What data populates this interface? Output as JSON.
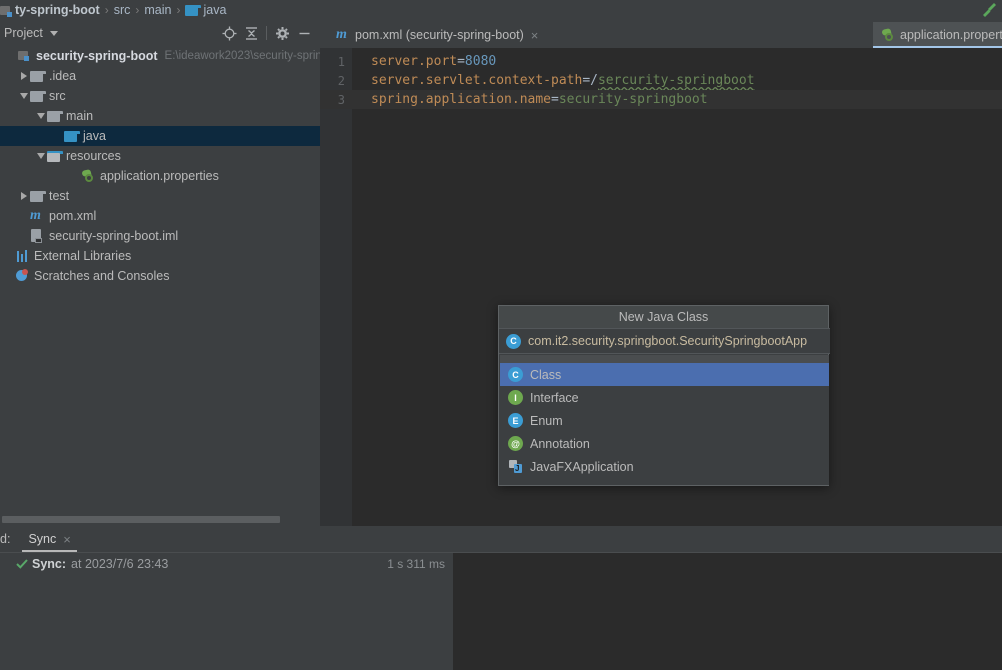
{
  "breadcrumb": {
    "items": [
      {
        "label": "ty-spring-boot",
        "icon": "module-icon",
        "bold": true
      },
      {
        "label": "src",
        "icon": "none",
        "bold": false
      },
      {
        "label": "main",
        "icon": "none",
        "bold": false
      },
      {
        "label": "java",
        "icon": "folder-icon",
        "bold": false
      }
    ],
    "separator": "›",
    "build_icon": "hammer-icon"
  },
  "project_panel": {
    "title": "Project",
    "toolbar": [
      {
        "name": "locate-icon",
        "label": "Select Opened File"
      },
      {
        "name": "collapse-all-icon",
        "label": "Collapse All"
      },
      {
        "name": "gear-icon",
        "label": "Settings"
      },
      {
        "name": "minimize-icon",
        "label": "Hide"
      }
    ],
    "tree": [
      {
        "indent": 0,
        "arrow": "none",
        "icon": "module-icon",
        "label": "security-spring-boot",
        "bold": true,
        "path": "E:\\ideawork2023\\security-sprin",
        "selected": false
      },
      {
        "indent": 1,
        "arrow": "right",
        "icon": "folder-grey",
        "label": ".idea",
        "bold": false,
        "path": "",
        "selected": false
      },
      {
        "indent": 1,
        "arrow": "down",
        "icon": "folder-grey",
        "label": "src",
        "bold": false,
        "path": "",
        "selected": false
      },
      {
        "indent": 2,
        "arrow": "down",
        "icon": "folder-grey",
        "label": "main",
        "bold": false,
        "path": "",
        "selected": false
      },
      {
        "indent": 3,
        "arrow": "none",
        "icon": "folder-blue",
        "label": "java",
        "bold": false,
        "path": "",
        "selected": true
      },
      {
        "indent": 3,
        "arrow": "down",
        "icon": "folder-res",
        "label": "resources",
        "bold": false,
        "path": "",
        "selected": false
      },
      {
        "indent": 4,
        "arrow": "none",
        "icon": "properties-icon",
        "label": "application.properties",
        "bold": false,
        "path": "",
        "selected": false
      },
      {
        "indent": 1,
        "arrow": "right",
        "icon": "folder-grey",
        "label": "test",
        "bold": false,
        "path": "",
        "selected": false
      },
      {
        "indent": 1,
        "arrow": "none",
        "icon": "maven-icon",
        "label": "pom.xml",
        "bold": false,
        "path": "",
        "selected": false
      },
      {
        "indent": 1,
        "arrow": "none",
        "icon": "iml-icon",
        "label": "security-spring-boot.iml",
        "bold": false,
        "path": "",
        "selected": false
      },
      {
        "indent": 0,
        "arrow": "none",
        "icon": "library-icon",
        "label": "External Libraries",
        "bold": false,
        "path": "",
        "selected": false
      },
      {
        "indent": 0,
        "arrow": "none",
        "icon": "scratch-icon",
        "label": "Scratches and Consoles",
        "bold": false,
        "path": "",
        "selected": false
      }
    ]
  },
  "editor_tabs": [
    {
      "label": "pom.xml (security-spring-boot)",
      "icon": "maven-icon",
      "active": false,
      "close": "×"
    },
    {
      "label": "application.properties",
      "icon": "properties-icon",
      "active": true,
      "close": "×"
    }
  ],
  "editor": {
    "lines": [
      {
        "number": "1",
        "caret": false,
        "tokens": [
          {
            "text": "server.port",
            "type": "key"
          },
          {
            "text": "=",
            "type": "eq"
          },
          {
            "text": "8080",
            "type": "num"
          }
        ]
      },
      {
        "number": "2",
        "caret": false,
        "tokens": [
          {
            "text": "server.servlet.context-path",
            "type": "key"
          },
          {
            "text": "=/",
            "type": "val"
          },
          {
            "text": "sercurity-springboot",
            "type": "err"
          }
        ]
      },
      {
        "number": "3",
        "caret": true,
        "tokens": [
          {
            "text": "spring.application.name",
            "type": "key"
          },
          {
            "text": "=",
            "type": "eq"
          },
          {
            "text": "security-springboot",
            "type": "val"
          }
        ]
      }
    ]
  },
  "popup": {
    "title": "New Java Class",
    "input_value": "com.it2.security.springboot.SecuritySpringbootApp",
    "items": [
      {
        "label": "Class",
        "icon": "class-icon",
        "glyph": "C",
        "selected": true
      },
      {
        "label": "Interface",
        "icon": "interface-icon",
        "glyph": "I",
        "selected": false
      },
      {
        "label": "Enum",
        "icon": "enum-icon",
        "glyph": "E",
        "selected": false
      },
      {
        "label": "Annotation",
        "icon": "annotation-icon",
        "glyph": "@",
        "selected": false
      },
      {
        "label": "JavaFXApplication",
        "icon": "javafx-icon",
        "glyph": "",
        "selected": false
      }
    ]
  },
  "bottom_panel": {
    "prefix_label": "d:",
    "tab": {
      "label": "Sync",
      "close": "×",
      "active": true
    },
    "rows": [
      {
        "status_icon": "check-icon",
        "label": "Sync:",
        "time": "at 2023/7/6 23:43",
        "duration": "1 s 311 ms"
      }
    ]
  },
  "colors": {
    "panel_bg": "#3c3f41",
    "editor_bg": "#2b2b2b",
    "selection_tree": "#0d293e",
    "selection_list": "#4b6eaf",
    "accent_blue": "#3592c4",
    "green": "#6ea84f",
    "key_orange": "#bf8b56",
    "string_green": "#6a8759",
    "number_blue": "#6897bb"
  }
}
